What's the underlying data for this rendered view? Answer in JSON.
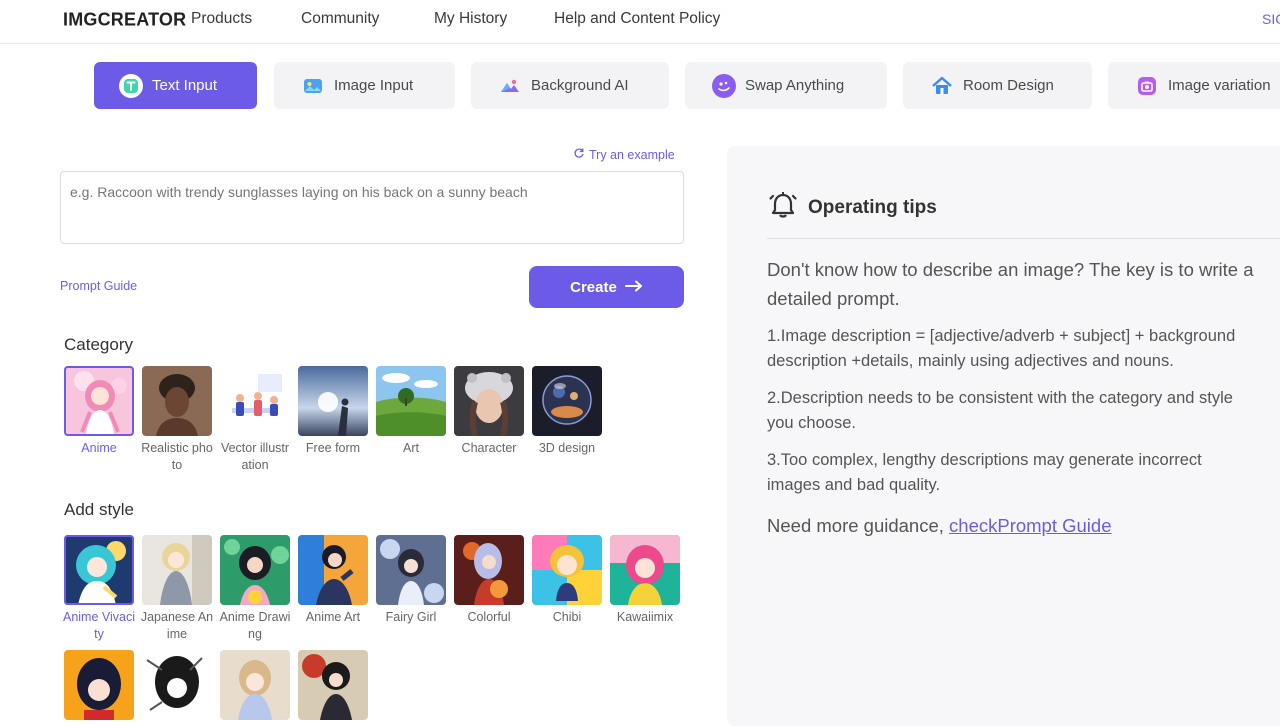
{
  "nav": {
    "logo": "IMGCREATOR",
    "links": [
      "Products",
      "Community",
      "My History",
      "Help and Content Policy"
    ],
    "signin": "SIGN IN"
  },
  "tabs": [
    {
      "label": "Text Input",
      "icon": "text-icon"
    },
    {
      "label": "Image Input",
      "icon": "image-icon"
    },
    {
      "label": "Background AI",
      "icon": "background-icon"
    },
    {
      "label": "Swap Anything",
      "icon": "swap-icon"
    },
    {
      "label": "Room Design",
      "icon": "house-icon"
    },
    {
      "label": "Image variation",
      "icon": "camera-icon"
    }
  ],
  "prompt": {
    "try_example": "Try an example",
    "placeholder": "e.g. Raccoon with trendy sunglasses laying on his back on a sunny beach",
    "guide_link": "Prompt Guide",
    "create_label": "Create"
  },
  "category": {
    "title": "Category",
    "items": [
      "Anime",
      "Realistic photo",
      "Vector illustration",
      "Free form",
      "Art",
      "Character",
      "3D design"
    ],
    "selected": "Anime"
  },
  "style": {
    "title": "Add style",
    "items": [
      "Anime Vivacity",
      "Japanese Anime",
      "Anime Drawing",
      "Anime Art",
      "Fairy Girl",
      "Colorful",
      "Chibi",
      "Kawaiimix"
    ],
    "selected": "Anime Vivacity"
  },
  "tips": {
    "title": "Operating tips",
    "intro_line1": "Don't know how to describe an image? The key is to write a",
    "intro_line2": "detailed prompt.",
    "tip1_line1": "1.Image description = [adjective/adverb + subject] + background",
    "tip1_line2": "description +details, mainly using adjectives and nouns.",
    "tip2_line1": "2.Description needs to be consistent with the category and style",
    "tip2_line2": "you choose.",
    "tip3_line1": "3.Too complex, lengthy descriptions may generate incorrect",
    "tip3_line2": "images and bad quality.",
    "more_prefix": "Need more guidance, ",
    "more_link": "checkPrompt Guide"
  },
  "colors": {
    "accent": "#6b5be6",
    "link": "#6b5cf0",
    "panel_bg": "#f7f7f9"
  }
}
